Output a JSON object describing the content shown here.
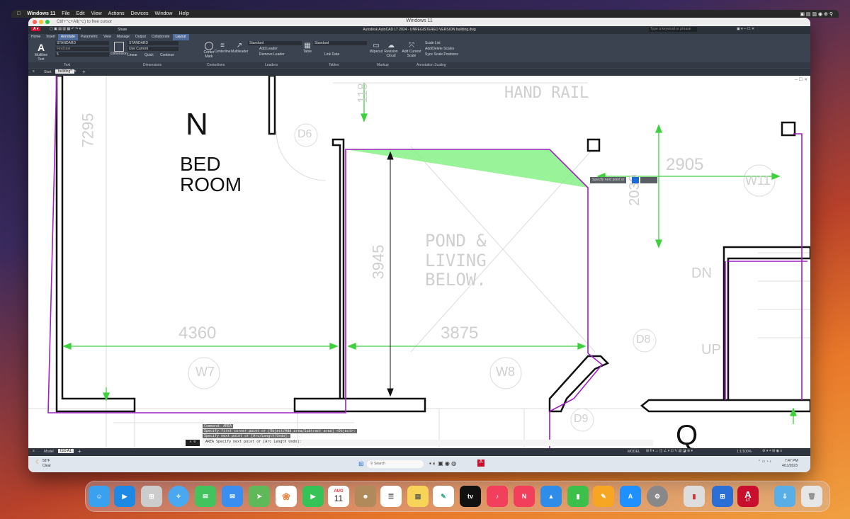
{
  "mac_menu": {
    "items": [
      "Windows 11",
      "File",
      "Edit",
      "View",
      "Actions",
      "Devices",
      "Window",
      "Help"
    ]
  },
  "vm": {
    "title": "Windows 11",
    "hint": "Ctrl+⌥+Alt(⌥) to free cursor"
  },
  "acad": {
    "title": "Autodesk AutoCAD LT 2024 - UNREGISTERED VERSION   building.dwg",
    "share": "Share",
    "search_placeholder": "Type a keyword or phrase"
  },
  "ribbon": {
    "tabs": [
      "Home",
      "Insert",
      "Annotate",
      "Parametric",
      "View",
      "Manage",
      "Output",
      "Collaborate",
      "Layout"
    ],
    "active_tab": "Annotate",
    "mtext": "Multiline Text",
    "text_style": "STANDARD",
    "find_text": "Find text",
    "text_height": "5",
    "dimension": "Dimension",
    "dim_style": "STANDARD",
    "use_current": "Use Current",
    "linear": "Linear",
    "quick": "Quick",
    "continue": "Continue",
    "center_mark": "Center Mark",
    "centerline": "Centerline",
    "multileader": "Multileader",
    "leader_style": "Standard",
    "add_leader": "Add Leader",
    "remove_leader": "Remove Leader",
    "table": "Table",
    "table_style": "Standard",
    "link_data": "Link Data",
    "wipeout": "Wipeout",
    "revision_cloud": "Revision Cloud",
    "add_current_scale": "Add Current Scale",
    "scale_list": "Scale List",
    "add_delete_scales": "Add/Delete Scales",
    "sync_scale": "Sync Scale Positions",
    "panels": [
      "Text",
      "Dimensions",
      "Centerlines",
      "Leaders",
      "Tables",
      "Markup",
      "Annotation Scaling"
    ]
  },
  "doc_tabs": {
    "start": "Start",
    "active": "building*"
  },
  "drawing": {
    "room_letter": "N",
    "room_name_1": "BED",
    "room_name_2": "ROOM",
    "q_letter": "Q",
    "hand_rail": "HAND RAIL",
    "pond_1": "POND &",
    "pond_2": "LIVING",
    "pond_3": "BELOW.",
    "dim_4360": "4360",
    "dim_3875": "3875",
    "dim_3945": "3945",
    "dim_2905": "2905",
    "dim_2030": "2030",
    "dim_7295": "7295",
    "dim_118": "118",
    "w7": "W7",
    "w8": "W8",
    "w11": "W11",
    "d6": "D6",
    "d8": "D8",
    "d9": "D9",
    "dn": "DN",
    "up": "UP",
    "tooltip": "Specify next point or"
  },
  "command": {
    "history_1": "Command: AREA",
    "history_2": "Specify first corner point or [Object/Add area/Subtract area] <Object>:",
    "history_3": "Specify next point or [Arc/Length/Undo]:",
    "prompt": "AREA Specify next point or [Arc Length Undo]:"
  },
  "status": {
    "model": "Model",
    "layout": "ISO A1",
    "mode": "MODEL",
    "scale": "1:1/100%"
  },
  "taskbar": {
    "weather_temp": "58°F",
    "weather_desc": "Clear",
    "search": "Search",
    "time": "7:47 PM",
    "date": "4/11/2023"
  },
  "dock": {
    "calendar_month": "AUG",
    "calendar_day": "11",
    "acad_label": "A",
    "acad_sub": "LT"
  },
  "colors": {
    "accent": "#4e6b9a",
    "purple_line": "#a020c0",
    "green_dim": "#3dd13d",
    "area_fill": "#7ff07f"
  }
}
